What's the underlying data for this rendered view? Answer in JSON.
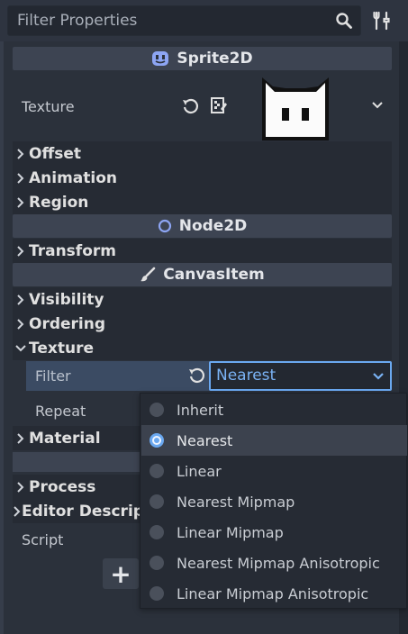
{
  "search": {
    "placeholder": "Filter Properties"
  },
  "sections": {
    "sprite2d": "Sprite2D",
    "node2d": "Node2D",
    "canvasitem": "CanvasItem"
  },
  "properties": {
    "texture_label": "Texture",
    "filter_label": "Filter",
    "repeat_label": "Repeat",
    "script_label": "Script"
  },
  "groups": {
    "offset": "Offset",
    "animation": "Animation",
    "region": "Region",
    "transform": "Transform",
    "visibility": "Visibility",
    "ordering": "Ordering",
    "texture": "Texture",
    "material": "Material",
    "process": "Process",
    "editor_description": "Editor Descript"
  },
  "filter_dropdown": {
    "selected": "Nearest",
    "options": [
      "Inherit",
      "Nearest",
      "Linear",
      "Nearest Mipmap",
      "Linear Mipmap",
      "Nearest Mipmap Anisotropic",
      "Linear Mipmap Anisotropic"
    ]
  },
  "add_button": "+",
  "colors": {
    "accent": "#6aa8f0",
    "node2d": "#8da5f3",
    "sprite": "#8da5f3"
  }
}
